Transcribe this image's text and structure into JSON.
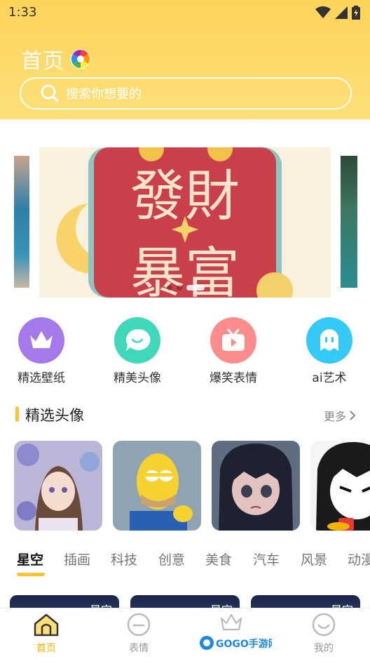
{
  "status_bar": {
    "time": "1:33"
  },
  "header": {
    "title": "首页",
    "search_placeholder": "搜索你想要的"
  },
  "banner": {
    "text_line1": "發財",
    "text_line2": "暴富",
    "dot_count": 3,
    "active_dot": 2
  },
  "categories": [
    {
      "label": "精选壁纸",
      "icon": "crown-icon",
      "color": "#a679ea"
    },
    {
      "label": "精美头像",
      "icon": "chat-bubble-icon",
      "color": "#3fd8b9"
    },
    {
      "label": "爆笑表情",
      "icon": "tv-play-icon",
      "color": "#fd8c8c"
    },
    {
      "label": "ai艺术",
      "icon": "ghost-icon",
      "color": "#34c9f6"
    }
  ],
  "featured_section": {
    "title": "精选头像",
    "more_label": "更多"
  },
  "tabs": [
    {
      "label": "星空",
      "active": true
    },
    {
      "label": "插画"
    },
    {
      "label": "科技"
    },
    {
      "label": "创意"
    },
    {
      "label": "美食"
    },
    {
      "label": "汽车"
    },
    {
      "label": "风景"
    },
    {
      "label": "动漫"
    }
  ],
  "wallpaper_cards": [
    {
      "label": "星空"
    },
    {
      "label": "星空"
    },
    {
      "label": "星空"
    }
  ],
  "bottom_nav": [
    {
      "label": "首页",
      "icon": "home-icon",
      "active": true
    },
    {
      "label": "表情",
      "icon": "emoji-icon"
    },
    {
      "label": "",
      "icon": "crown-icon"
    },
    {
      "label": "我的",
      "icon": "profile-smile-icon"
    }
  ],
  "watermark": {
    "text": "GOGO手游网"
  },
  "colors": {
    "header_yellow": "#fdd35a",
    "accent": "#fdc432",
    "nav_active": "#f2b300"
  }
}
